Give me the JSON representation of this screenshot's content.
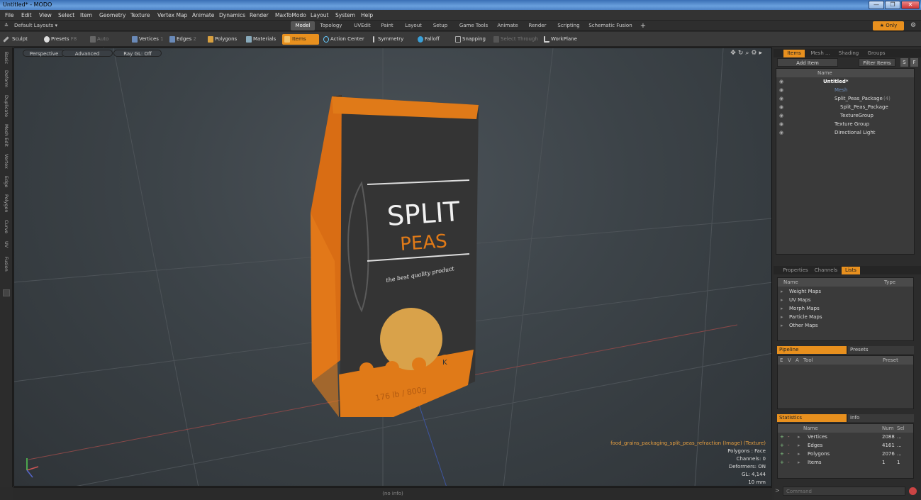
{
  "window": {
    "title": "Untitled* - MODO",
    "buttons": [
      "—",
      "❐",
      "✕"
    ]
  },
  "menu": [
    "File",
    "Edit",
    "View",
    "Select",
    "Item",
    "Geometry",
    "Texture",
    "Vertex Map",
    "Animate",
    "Dynamics",
    "Render",
    "MaxToModo",
    "Layout",
    "System",
    "Help"
  ],
  "layout": {
    "preset": "Default Layouts ▾",
    "tabs": [
      "Model",
      "Topology",
      "UVEdit",
      "Paint",
      "Layout",
      "Setup",
      "Game Tools",
      "Animate",
      "Render",
      "Scripting",
      "Schematic Fusion"
    ],
    "active_tab": "Model",
    "add": "+",
    "only": "★ Only"
  },
  "toolbar": {
    "sculpt": "Sculpt",
    "presets": "Presets",
    "presets_key": "F8",
    "auto_select": "Auto Select",
    "vertices": "Vertices",
    "vertices_key": "1",
    "edges": "Edges",
    "edges_key": "2",
    "polygons": "Polygons",
    "materials": "Materials",
    "items": "Items",
    "action_center": "Action Center",
    "symmetry": "Symmetry",
    "falloff": "Falloff",
    "snapping": "Snapping",
    "select_through": "Select Through",
    "workplane": "WorkPlane"
  },
  "left_tabs": [
    "Basic",
    "Deform",
    "Duplicate",
    "Mesh Edit",
    "Vertex",
    "Edge",
    "Polygon",
    "Curve",
    "UV",
    "Fusion"
  ],
  "viewport": {
    "view": "Perspective",
    "mode": "Advanced",
    "raygl": "Ray GL: Off",
    "info": [
      "food_grains_packaging_split_peas_refraction (Image) (Texture)",
      "Polygons : Face",
      "Channels: 0",
      "Deformers: ON",
      "GL: 4,144",
      "10 mm"
    ],
    "status": "(no info)",
    "package": {
      "title1": "SPLIT",
      "title2": "PEAS",
      "tagline": "the best quality product",
      "weight": "176 lb / 800g",
      "badge": "K"
    }
  },
  "items_panel": {
    "tabs": [
      "Items",
      "Mesh ...",
      "Shading",
      "Groups"
    ],
    "add_item": "Add Item",
    "filter": "Filter Items",
    "s": "S",
    "f": "F",
    "col_name": "Name",
    "tree": [
      {
        "label": "Untitled*"
      },
      {
        "label": "Mesh"
      },
      {
        "label": "Split_Peas_Package",
        "count": "(4)"
      },
      {
        "label": "Split_Peas_Package"
      },
      {
        "label": "TextureGroup"
      },
      {
        "label": "Texture Group"
      },
      {
        "label": "Directional Light"
      }
    ]
  },
  "props_panel": {
    "tabs": [
      "Properties",
      "Channels",
      "Lists"
    ],
    "col_name": "Name",
    "col_type": "Type",
    "rows": [
      "Weight Maps",
      "UV Maps",
      "Morph Maps",
      "Particle Maps",
      "Other Maps"
    ]
  },
  "pipeline": {
    "tab": "Pipeline",
    "tab2": "Presets",
    "cols": [
      "E",
      "V",
      "A",
      "Tool",
      "Preset"
    ]
  },
  "stats": {
    "tab": "Statistics",
    "tab2": "Info",
    "cols": [
      "Name",
      "Num",
      "Sel"
    ],
    "rows": [
      {
        "name": "Vertices",
        "num": "2088",
        "sel": "..."
      },
      {
        "name": "Edges",
        "num": "4161",
        "sel": "..."
      },
      {
        "name": "Polygons",
        "num": "2076",
        "sel": "..."
      },
      {
        "name": "Items",
        "num": "1",
        "sel": "1"
      }
    ]
  },
  "command": {
    "placeholder": "Command"
  }
}
